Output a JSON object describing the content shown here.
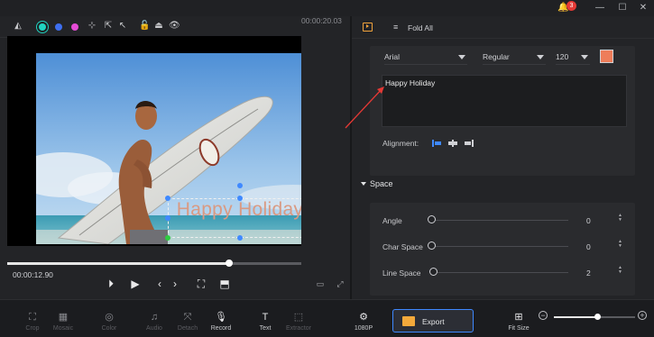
{
  "titlebar": {
    "notification_count": "3",
    "icons": [
      "bell-icon",
      "minimize-icon",
      "maximize-icon",
      "close-icon"
    ]
  },
  "preview": {
    "caption_text": "Happy Holiday",
    "current_time": "00:00:12.90",
    "total_time": "00:00:20.03",
    "progress": 0.66
  },
  "panel": {
    "fold_all": "Fold All",
    "font": "Arial",
    "style": "Regular",
    "size": "120",
    "text_color": "#ee7d5a",
    "text_value": "Happy Holiday",
    "alignment_label": "Alignment:",
    "space_section": "Space",
    "angle_label": "Angle",
    "angle_value": "0",
    "charspace_label": "Char Space",
    "charspace_value": "0",
    "linespace_label": "Line Space",
    "linespace_value": "2"
  },
  "bottombar": {
    "crop": "Crop",
    "mosaic": "Mosaic",
    "color": "Color",
    "audio": "Audio",
    "detach": "Detach",
    "record": "Record",
    "text": "Text",
    "extractor": "Extractor",
    "resolution": "1080P",
    "export": "Export",
    "fit_size": "Fit Size",
    "zoom_level": 0.53
  },
  "colors": {
    "accent": "#3f89ff",
    "export_icon": "#f3a93b",
    "caption": "#d99a83"
  }
}
